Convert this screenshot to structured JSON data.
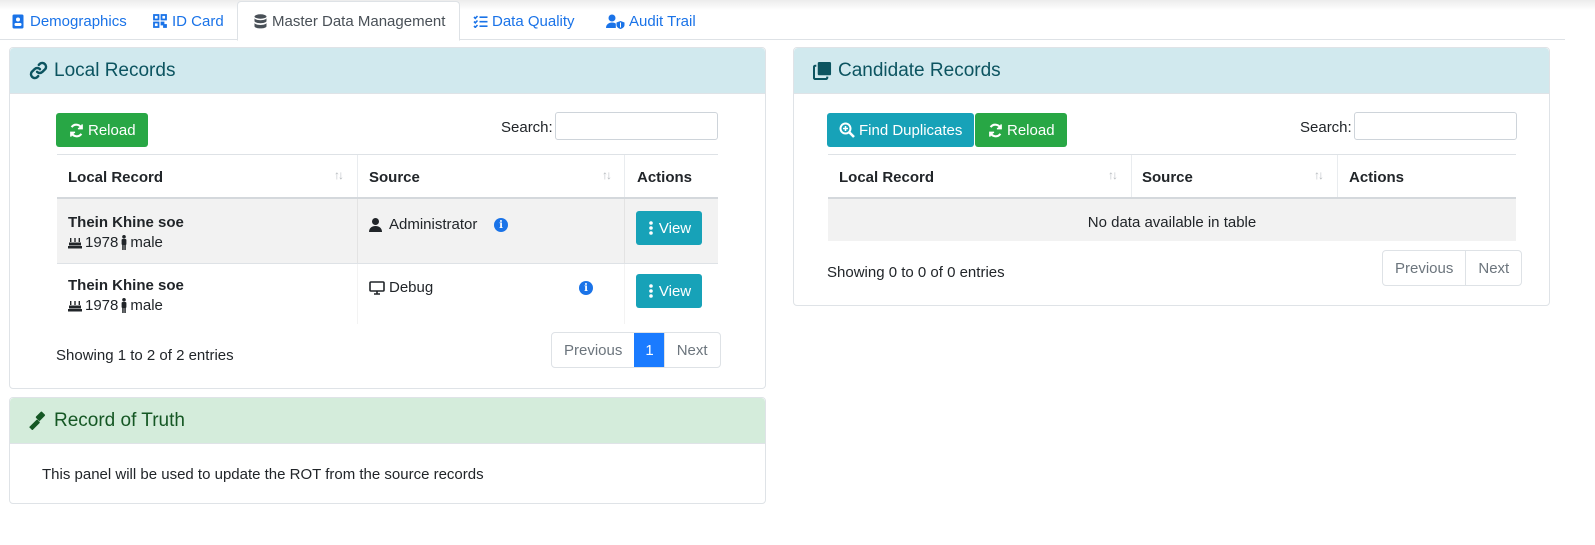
{
  "tabs": [
    {
      "label": "Demographics",
      "icon": "id-badge-icon",
      "active": false
    },
    {
      "label": "ID Card",
      "icon": "qrcode-icon",
      "active": false
    },
    {
      "label": "Master Data Management",
      "icon": "database-icon",
      "active": true
    },
    {
      "label": "Data Quality",
      "icon": "tasks-icon",
      "active": false
    },
    {
      "label": "Audit Trail",
      "icon": "user-shield-icon",
      "active": false
    }
  ],
  "colors": {
    "link": "#1a73e8",
    "green": "#28a745",
    "teal": "#17a2b8",
    "info_head": "#d1e9ee",
    "success_head": "#d4ecdb",
    "page_active": "#1a7bff"
  },
  "local_records": {
    "title": "Local Records",
    "icon": "link-icon",
    "reload_label": "Reload",
    "search_label": "Search:",
    "search_value": "",
    "columns": [
      "Local Record",
      "Source",
      "Actions"
    ],
    "rows": [
      {
        "name": "Thein Khine soe",
        "birth_year": "1978",
        "gender": "male",
        "source": "Administrator",
        "source_icon": "user-icon",
        "action": "View"
      },
      {
        "name": "Thein Khine soe",
        "birth_year": "1978",
        "gender": "male",
        "source": "Debug",
        "source_icon": "desktop-icon",
        "action": "View"
      }
    ],
    "info": "Showing 1 to 2 of 2 entries",
    "pagination": {
      "previous": "Previous",
      "current": "1",
      "next": "Next"
    }
  },
  "candidate_records": {
    "title": "Candidate Records",
    "icon": "clone-icon",
    "find_label": "Find Duplicates",
    "reload_label": "Reload",
    "search_label": "Search:",
    "search_value": "",
    "columns": [
      "Local Record",
      "Source",
      "Actions"
    ],
    "empty_text": "No data available in table",
    "info": "Showing 0 to 0 of 0 entries",
    "pagination": {
      "previous": "Previous",
      "next": "Next"
    }
  },
  "record_of_truth": {
    "title": "Record of Truth",
    "icon": "gavel-icon",
    "body": "This panel will be used to update the ROT from the source records"
  }
}
